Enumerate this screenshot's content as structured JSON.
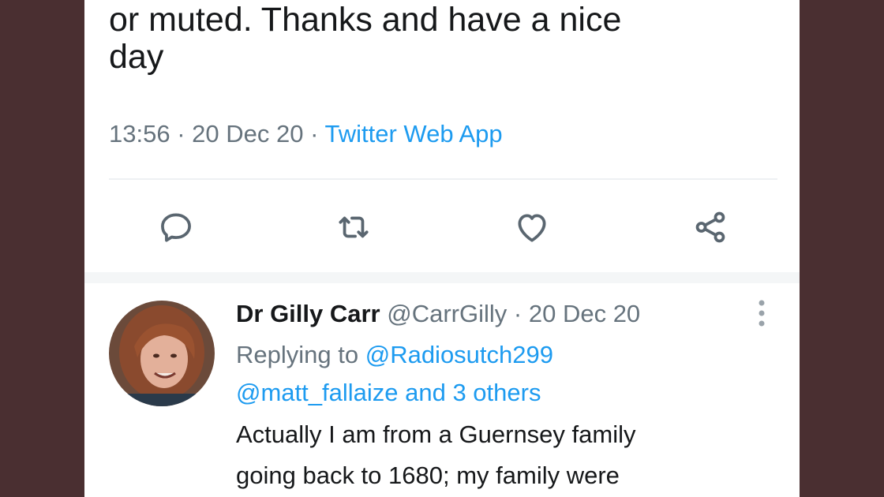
{
  "tweet": {
    "text_line1": "or muted. Thanks and have a nice",
    "text_line2": "day",
    "time": "13:56",
    "date": "20 Dec 20",
    "source": "Twitter Web App",
    "separator": "·"
  },
  "actions": [
    {
      "icon": "reply-icon"
    },
    {
      "icon": "retweet-icon"
    },
    {
      "icon": "heart-icon"
    },
    {
      "icon": "share-icon"
    }
  ],
  "reply": {
    "name": "Dr Gilly Carr",
    "handle": "@CarrGilly",
    "date": "20 Dec 20",
    "replying_prefix": "Replying to",
    "replying_to": "@Radiosutch299",
    "others_line": "@matt_fallaize and 3 others",
    "body_line1": "Actually I am from a Guernsey family",
    "body_line2": "going back to 1680; my family were"
  },
  "colors": {
    "accent": "#1d9bf0",
    "muted": "#66737d",
    "background": "#4a2f31"
  }
}
